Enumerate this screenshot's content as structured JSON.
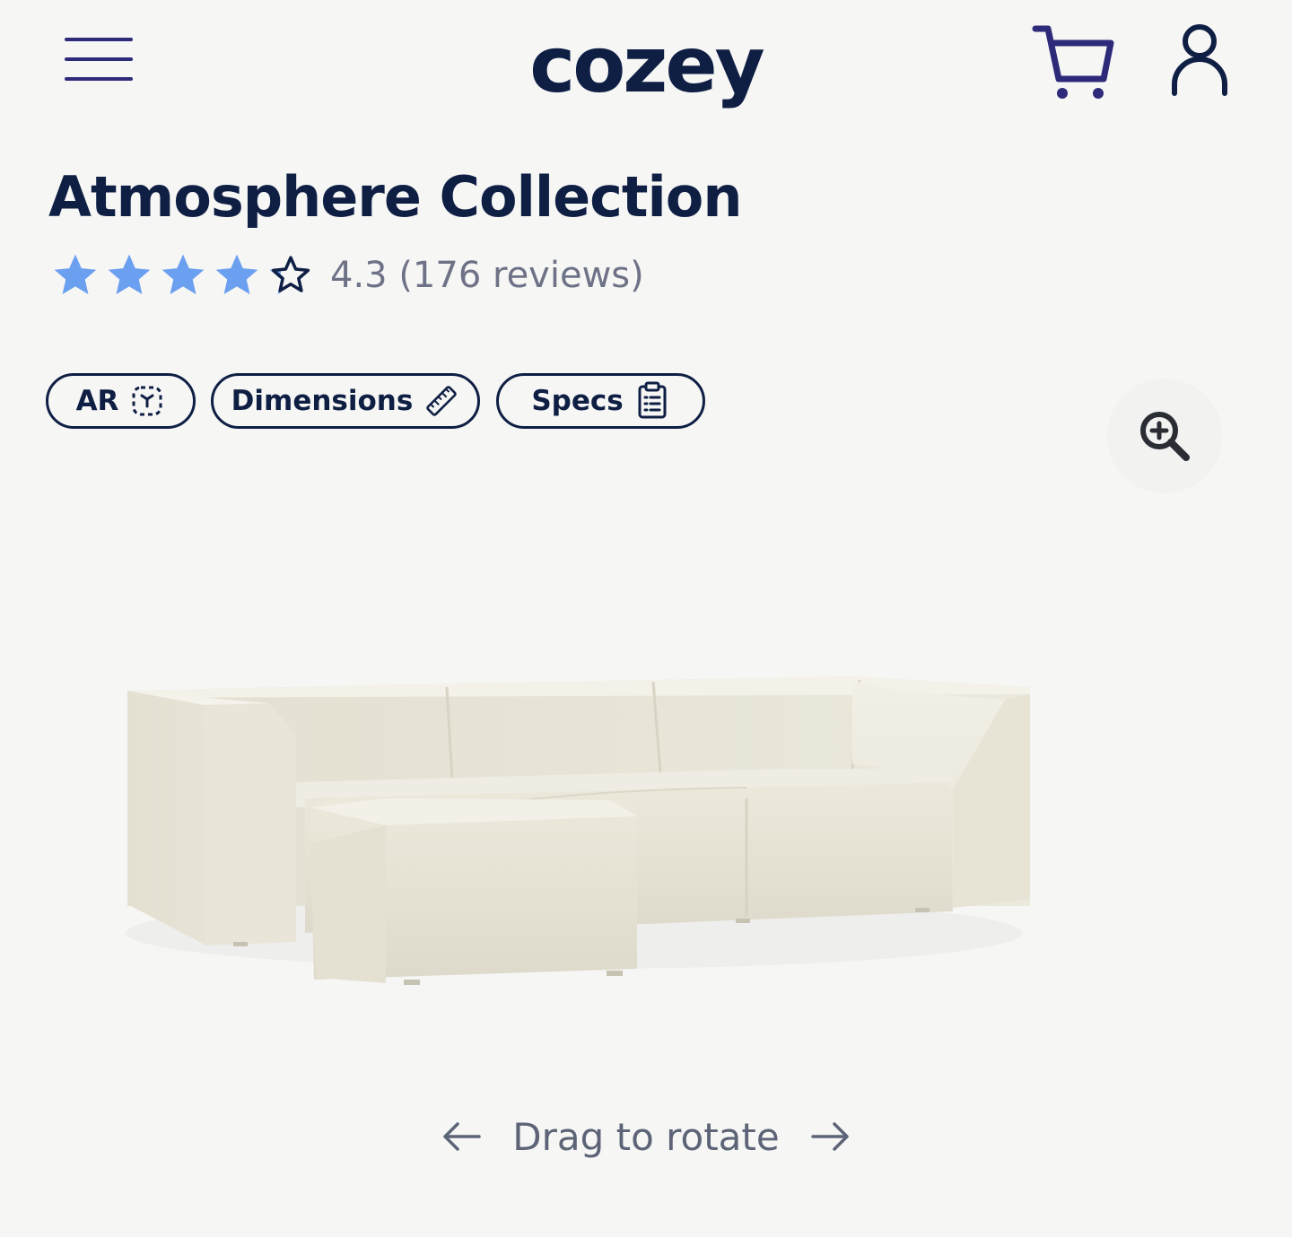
{
  "header": {
    "logo_text": "cozey",
    "brand_color": "#0f1f44",
    "icon_color": "#2e2a7a",
    "menu_icon": "hamburger-menu-icon",
    "cart_icon": "shopping-cart-icon",
    "account_icon": "user-account-icon"
  },
  "product": {
    "title": "Atmosphere Collection",
    "rating": {
      "value": 4.3,
      "max": 5,
      "text": "4.3 (176 reviews)",
      "star_color": "#6b9ff0"
    },
    "actions": [
      {
        "label": "AR",
        "icon": "ar-scan-icon"
      },
      {
        "label": "Dimensions",
        "icon": "ruler-icon"
      },
      {
        "label": "Specs",
        "icon": "clipboard-icon"
      }
    ],
    "zoom_icon": "zoom-in-icon",
    "image_alt": "sofa-image",
    "rotate_hint": "Drag to rotate"
  }
}
